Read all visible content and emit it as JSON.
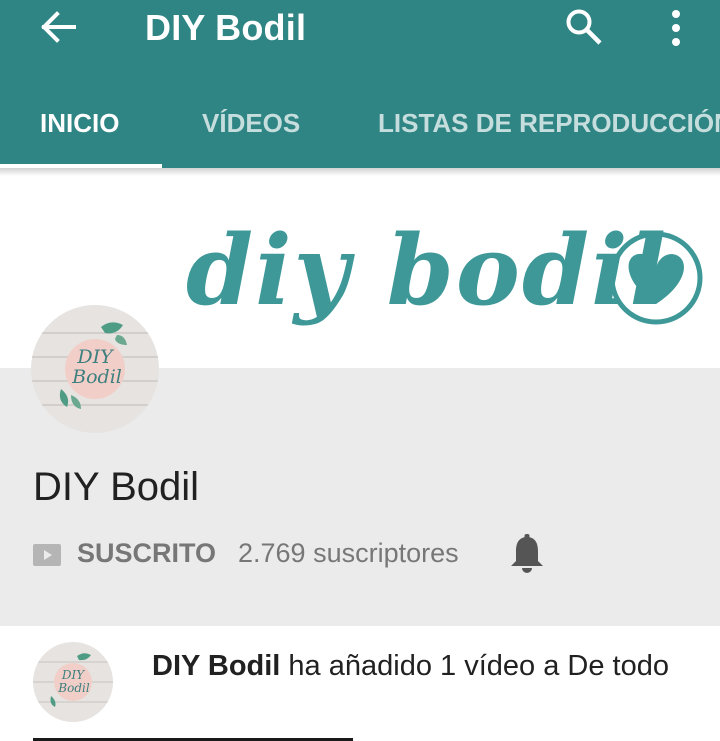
{
  "appbar": {
    "back_icon": "arrow-back-icon",
    "title": "DIY Bodil",
    "search_icon": "search-icon",
    "more_icon": "more-vert-icon",
    "background_color": "#2f8484"
  },
  "tabs": [
    {
      "label": "INICIO",
      "active": true
    },
    {
      "label": "VÍDEOS",
      "active": false
    },
    {
      "label": "LISTAS DE REPRODUCCIÓN",
      "active": false
    }
  ],
  "banner": {
    "logo_text": "diy bodil",
    "logo_icon": "heart-icon",
    "logo_color": "#3e9898"
  },
  "channel": {
    "avatar_text_line1": "DIY",
    "avatar_text_line2": "Bodil",
    "name": "DIY Bodil",
    "subscribe_icon": "play-box-icon",
    "subscribed_label": "SUSCRITO",
    "subscriber_count": "2.769 suscriptores",
    "notification_icon": "bell-icon"
  },
  "feed": {
    "author": "DIY Bodil",
    "action": " ha añadido 1 vídeo a De todo"
  }
}
